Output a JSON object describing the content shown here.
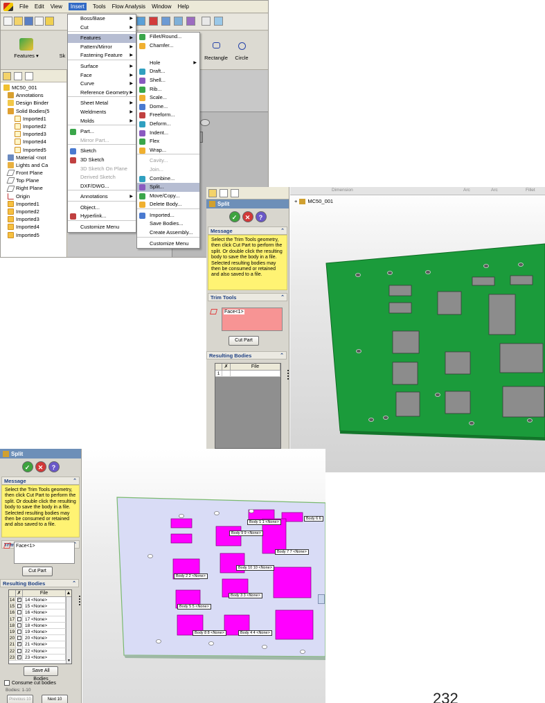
{
  "menubar": {
    "items": [
      "File",
      "Edit",
      "View",
      "Insert",
      "Tools",
      "Flow Analysis",
      "Window",
      "Help"
    ],
    "active": "Insert"
  },
  "command_manager": {
    "features_label": "Features",
    "sketch_short": "Sk",
    "rectangle_label": "Rectangle",
    "circle_label": "Circle"
  },
  "tree1": {
    "root": "MC50_001",
    "items": [
      "Annotations",
      "Design Binder",
      "Solid Bodies(5",
      "Imported1",
      "Imported2",
      "Imported3",
      "Imported4",
      "Imported5",
      "Material <not",
      "Lights and Ca",
      "Front Plane",
      "Top Plane",
      "Right Plane",
      "Origin",
      "Imported1",
      "Imported2",
      "Imported3",
      "Imported4",
      "Imported5"
    ]
  },
  "insert_menu": {
    "items": [
      {
        "label": "Boss/Base",
        "sub": true
      },
      {
        "label": "Cut",
        "sub": true,
        "sep": true
      },
      {
        "label": "Features",
        "sub": true,
        "hl": true
      },
      {
        "label": "Pattern/Mirror",
        "sub": true
      },
      {
        "label": "Fastening Feature",
        "sub": true,
        "sep": true
      },
      {
        "label": "Surface",
        "sub": true
      },
      {
        "label": "Face",
        "sub": true
      },
      {
        "label": "Curve",
        "sub": true
      },
      {
        "label": "Reference Geometry",
        "sub": true,
        "sep": true
      },
      {
        "label": "Sheet Metal",
        "sub": true
      },
      {
        "label": "Weldments",
        "sub": true
      },
      {
        "label": "Molds",
        "sub": true,
        "sep": true
      },
      {
        "label": "Part...",
        "icon": true
      },
      {
        "label": "Mirror Part...",
        "dis": true,
        "sep": true
      },
      {
        "label": "Sketch",
        "icon": true
      },
      {
        "label": "3D Sketch",
        "icon": true
      },
      {
        "label": "3D Sketch On Plane",
        "dis": true
      },
      {
        "label": "Derived Sketch",
        "dis": true
      },
      {
        "label": "DXF/DWG...",
        "sep": true
      },
      {
        "label": "Annotations",
        "sub": true,
        "sep": true
      },
      {
        "label": "Object..."
      },
      {
        "label": "Hyperlink...",
        "icon": true,
        "sep": true
      },
      {
        "label": "Customize Menu"
      }
    ]
  },
  "features_menu": {
    "items": [
      {
        "label": "Fillet/Round...",
        "icon": true
      },
      {
        "label": "Chamfer...",
        "icon": true
      },
      {
        "label": "",
        "spacer": true
      },
      {
        "label": "Hole",
        "sub": true
      },
      {
        "label": "Draft...",
        "icon": true
      },
      {
        "label": "Shell...",
        "icon": true
      },
      {
        "label": "Rib...",
        "icon": true
      },
      {
        "label": "Scale...",
        "icon": true
      },
      {
        "label": "Dome...",
        "icon": true
      },
      {
        "label": "Freeform...",
        "icon": true
      },
      {
        "label": "Deform...",
        "icon": true
      },
      {
        "label": "Indent...",
        "icon": true
      },
      {
        "label": "Flex",
        "icon": true
      },
      {
        "label": "Wrap...",
        "icon": true,
        "sep": true
      },
      {
        "label": "Cavity...",
        "dis": true
      },
      {
        "label": "Join...",
        "dis": true
      },
      {
        "label": "Combine...",
        "icon": true
      },
      {
        "label": "Split...",
        "icon": true,
        "hl": true
      },
      {
        "label": "Move/Copy...",
        "icon": true
      },
      {
        "label": "Delete Body...",
        "icon": true,
        "sep": true
      },
      {
        "label": "Imported...",
        "icon": true
      },
      {
        "label": "Save Bodies..."
      },
      {
        "label": "Create Assembly...",
        "sep": true
      },
      {
        "label": "Customize Menu"
      }
    ]
  },
  "split_panel": {
    "title": "Split",
    "message_header": "Message",
    "message": "Select the Trim Tools geometry, then click Cut Part to perform the split. Or double click the resulting body to save the body in a file. Selected resulting bodies may then be consumed or retained and also saved to a file.",
    "trim_tools_header": "Trim Tools",
    "trim_item": "Face<1>",
    "cut_part_label": "Cut Part",
    "resulting_bodies_header": "Resulting Bodies",
    "grid_col_file": "File",
    "grid_row_1": "1"
  },
  "viewport2": {
    "feature_tree_label": "MC50_001",
    "header_items": [
      "Dimension",
      "Arc",
      "Arc",
      "Fillet"
    ]
  },
  "split_panel3": {
    "rows": [
      {
        "n": "14",
        "file": "14 <None>",
        "checked": true
      },
      {
        "n": "15",
        "file": "15 <None>",
        "checked": false
      },
      {
        "n": "16",
        "file": "16 <None>",
        "checked": false
      },
      {
        "n": "17",
        "file": "17 <None>",
        "checked": false
      },
      {
        "n": "18",
        "file": "18 <None>",
        "checked": false
      },
      {
        "n": "19",
        "file": "19 <None>",
        "checked": false
      },
      {
        "n": "20",
        "file": "20 <None>",
        "checked": false
      },
      {
        "n": "21",
        "file": "21 <None>",
        "checked": true
      },
      {
        "n": "22",
        "file": "22 <None>",
        "checked": false
      },
      {
        "n": "23",
        "file": "23 <None>",
        "checked": true
      }
    ],
    "save_all_label": "Save All Bodies",
    "consume_label": "Consume cut bodies",
    "bodies_range": "Bodies: 1-10",
    "previous_label": "Previous 10",
    "next_label": "Next 10"
  },
  "body_tags": [
    {
      "text": "Body 1  1 <None>"
    },
    {
      "text": "Body 6  6"
    },
    {
      "text": "Body 9  9 <None>"
    },
    {
      "text": "Body 7  7 <None>"
    },
    {
      "text": "Body 2  2 <None>"
    },
    {
      "text": "Body 10  10 <None>"
    },
    {
      "text": "Body 3  3 <None>"
    },
    {
      "text": "Body 5  5 <None>"
    },
    {
      "text": "Body 8  8 <None>"
    },
    {
      "text": "Body 4  4 <None>"
    }
  ],
  "page_number": "232",
  "colors": {
    "pcb_green": "#1b9b3b",
    "body_magenta": "#ff00ff",
    "message_yellow": "#fff373",
    "trim_pink": "#f79494"
  }
}
